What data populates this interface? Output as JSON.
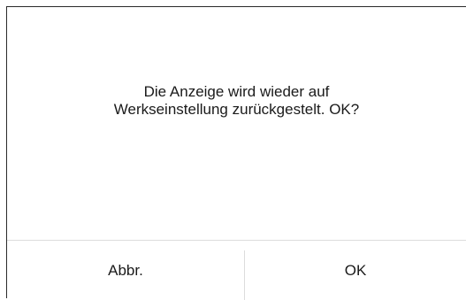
{
  "dialog": {
    "message_line1": "Die Anzeige wird wieder auf",
    "message_line2": "Werkseinstellung zurückgestelt. OK?",
    "cancel_label": "Abbr.",
    "ok_label": "OK"
  }
}
